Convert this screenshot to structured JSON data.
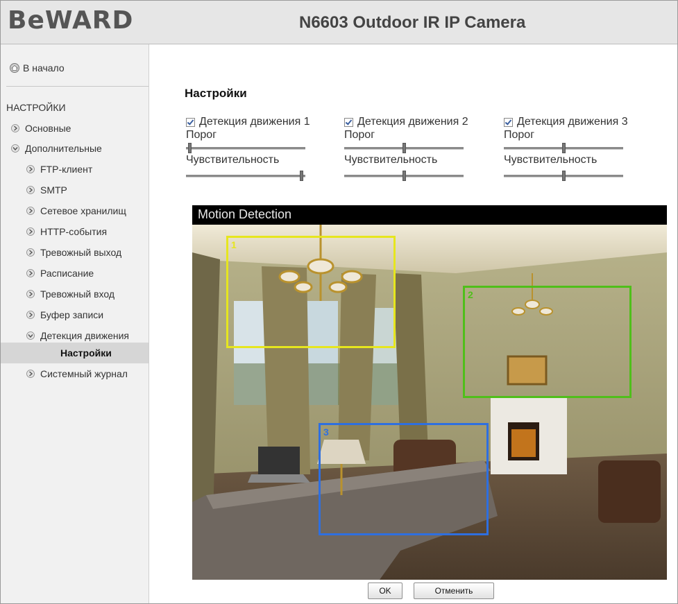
{
  "header": {
    "logo_text": "BeWARD",
    "product_title": "N6603 Outdoor IR IP Camera"
  },
  "sidebar": {
    "home_label": "В начало",
    "section_title": "НАСТРОЙКИ",
    "items": [
      {
        "label": "Основные",
        "icon": "chevron-right-icon"
      },
      {
        "label": "Дополнительные",
        "icon": "chevron-down-icon"
      },
      {
        "label": "FTP-клиент",
        "icon": "chevron-right-icon"
      },
      {
        "label": "SMTP",
        "icon": "chevron-right-icon"
      },
      {
        "label": "Сетевое хранилищ",
        "icon": "chevron-right-icon"
      },
      {
        "label": "HTTP-события",
        "icon": "chevron-right-icon"
      },
      {
        "label": "Тревожный выход",
        "icon": "chevron-right-icon"
      },
      {
        "label": "Расписание",
        "icon": "chevron-right-icon"
      },
      {
        "label": "Тревожный вход",
        "icon": "chevron-right-icon"
      },
      {
        "label": "Буфер записи",
        "icon": "chevron-right-icon"
      },
      {
        "label": "Детекция движения",
        "icon": "chevron-down-icon"
      },
      {
        "label": "Системный журнал",
        "icon": "chevron-right-icon"
      }
    ],
    "active_item": "Настройки"
  },
  "main": {
    "title": "Настройки",
    "detections": [
      {
        "label": "Детекция движения 1",
        "checked": true,
        "threshold_label": "Порог",
        "threshold_value": 0.02,
        "sensitivity_label": "Чувствительность",
        "sensitivity_value": 0.98
      },
      {
        "label": "Детекция движения 2",
        "checked": true,
        "threshold_label": "Порог",
        "threshold_value": 0.5,
        "sensitivity_label": "Чувствительность",
        "sensitivity_value": 0.5
      },
      {
        "label": "Детекция движения 3",
        "checked": true,
        "threshold_label": "Порог",
        "threshold_value": 0.5,
        "sensitivity_label": "Чувствительность",
        "sensitivity_value": 0.5
      }
    ]
  },
  "video": {
    "title": "Motion Detection",
    "zones": [
      {
        "number": "1",
        "color": "#e6e61e"
      },
      {
        "number": "2",
        "color": "#4fbf1a"
      },
      {
        "number": "3",
        "color": "#2e6fe0"
      }
    ]
  },
  "buttons": {
    "ok_label": "OK",
    "cancel_label": "Отменить"
  }
}
